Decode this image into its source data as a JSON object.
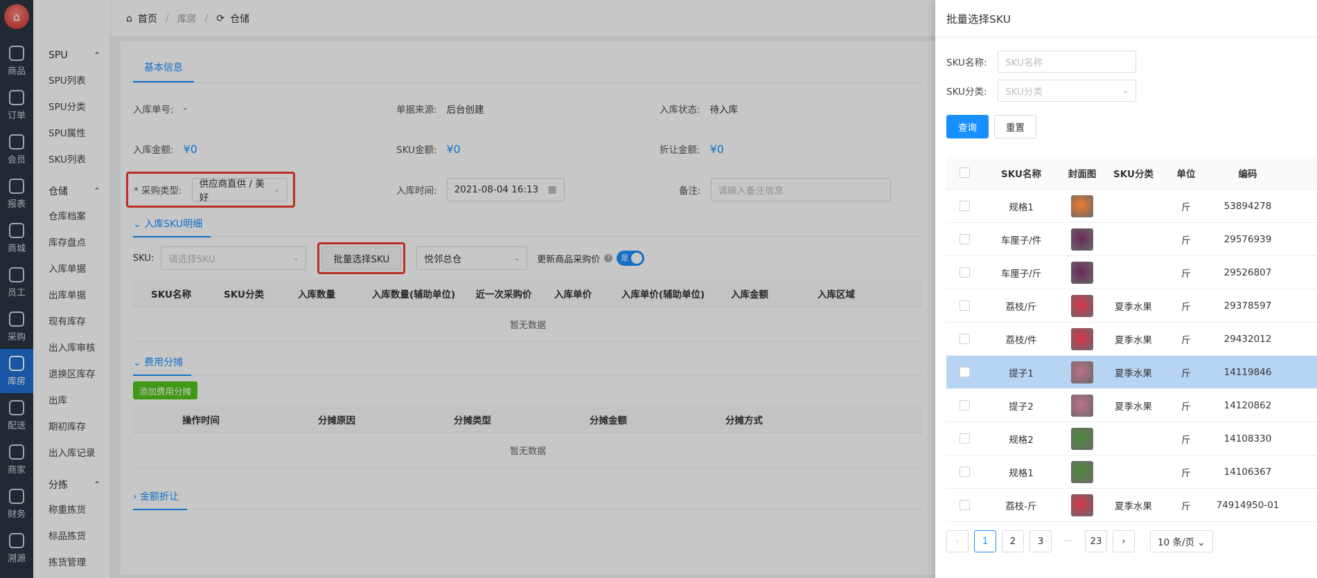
{
  "rail": [
    {
      "label": "商品",
      "icon": "bag-icon"
    },
    {
      "label": "订单",
      "icon": "order-icon"
    },
    {
      "label": "会员",
      "icon": "user-icon"
    },
    {
      "label": "报表",
      "icon": "chart-icon"
    },
    {
      "label": "商城",
      "icon": "home-icon"
    },
    {
      "label": "员工",
      "icon": "staff-icon"
    },
    {
      "label": "采购",
      "icon": "clipboard-icon"
    },
    {
      "label": "库房",
      "icon": "warehouse-icon"
    },
    {
      "label": "配送",
      "icon": "truck-icon"
    },
    {
      "label": "商家",
      "icon": "shop-icon"
    },
    {
      "label": "财务",
      "icon": "yen-icon"
    },
    {
      "label": "溯源",
      "icon": "trace-icon"
    }
  ],
  "menu": {
    "groups": [
      {
        "title": "SPU",
        "items": [
          "SPU列表",
          "SPU分类",
          "SPU属性",
          "SKU列表"
        ]
      },
      {
        "title": "仓储",
        "items": [
          "仓库档案",
          "库存盘点",
          "入库单据",
          "出库单据",
          "现有库存",
          "出入库审核",
          "退换区库存",
          "出库",
          "期初库存",
          "出入库记录"
        ]
      },
      {
        "title": "分拣",
        "items": [
          "称重拣货",
          "标品拣货",
          "拣货管理"
        ]
      }
    ]
  },
  "breadcrumb": {
    "home": "首页",
    "parent": "库房",
    "current": "仓储"
  },
  "form": {
    "tab": "基本信息",
    "order_no_label": "入库单号:",
    "order_no_value": "-",
    "source_label": "单据来源:",
    "source_value": "后台创建",
    "status_label": "入库状态:",
    "status_value": "待入库",
    "amount_label": "入库金额:",
    "amount_value": "¥0",
    "sku_amount_label": "SKU金额:",
    "sku_amount_value": "¥0",
    "discount_label": "折让金额:",
    "discount_value": "¥0",
    "purchase_type_label": "* 采购类型:",
    "purchase_type_value": "供应商直供 / 美好",
    "in_time_label": "入库时间:",
    "in_time_value": "2021-08-04 16:13",
    "remark_label": "备注:",
    "remark_placeholder": "请输入备注信息"
  },
  "sku_section": {
    "title": "入库SKU明细",
    "sku_label": "SKU:",
    "sku_placeholder": "请选择SKU",
    "batch_button": "批量选择SKU",
    "warehouse_value": "悦邻总仓",
    "update_price_label": "更新商品采购价",
    "switch_text": "是",
    "columns": [
      "SKU名称",
      "SKU分类",
      "入库数量",
      "入库数量(辅助单位)",
      "近一次采购价",
      "入库单价",
      "入库单价(辅助单位)",
      "入库金额",
      "入库区域"
    ],
    "empty": "暂无数据"
  },
  "fee_section": {
    "title": "费用分摊",
    "add_button": "添加费用分摊",
    "columns": [
      "操作时间",
      "分摊原因",
      "分摊类型",
      "分摊金额",
      "分摊方式"
    ],
    "empty": "暂无数据"
  },
  "discount_section": {
    "title": "金额折让"
  },
  "drawer": {
    "title": "批量选择SKU",
    "name_label": "SKU名称:",
    "name_placeholder": "SKU名称",
    "category_label": "SKU分类:",
    "category_placeholder": "SKU分类",
    "query_button": "查询",
    "reset_button": "重置",
    "columns": [
      "SKU名称",
      "封面图",
      "SKU分类",
      "单位",
      "编码"
    ],
    "rows": [
      {
        "name": "规格1",
        "category": "",
        "unit": "斤",
        "code": "53894278",
        "thumb": "#f07a2a"
      },
      {
        "name": "车厘子/件",
        "category": "",
        "unit": "斤",
        "code": "29576939",
        "thumb": "#6b2a5a"
      },
      {
        "name": "车厘子/斤",
        "category": "",
        "unit": "斤",
        "code": "29526807",
        "thumb": "#6b2a5a"
      },
      {
        "name": "荔枝/斤",
        "category": "夏季水果",
        "unit": "斤",
        "code": "29378597",
        "thumb": "#d8324a"
      },
      {
        "name": "荔枝/件",
        "category": "夏季水果",
        "unit": "斤",
        "code": "29432012",
        "thumb": "#d8324a"
      },
      {
        "name": "提子1",
        "category": "夏季水果",
        "unit": "斤",
        "code": "14119846",
        "thumb": "#c0708a"
      },
      {
        "name": "提子2",
        "category": "夏季水果",
        "unit": "斤",
        "code": "14120862",
        "thumb": "#c0708a"
      },
      {
        "name": "规格2",
        "category": "",
        "unit": "斤",
        "code": "14108330",
        "thumb": "#4d8a3a"
      },
      {
        "name": "规格1",
        "category": "",
        "unit": "斤",
        "code": "14106367",
        "thumb": "#4d8a3a"
      },
      {
        "name": "荔枝-斤",
        "category": "夏季水果",
        "unit": "斤",
        "code": "74914950-01",
        "thumb": "#d8324a"
      }
    ],
    "pager": {
      "pages": [
        "1",
        "2",
        "3"
      ],
      "ellipsis": "···",
      "last": "23",
      "size": "10 条/页"
    }
  }
}
